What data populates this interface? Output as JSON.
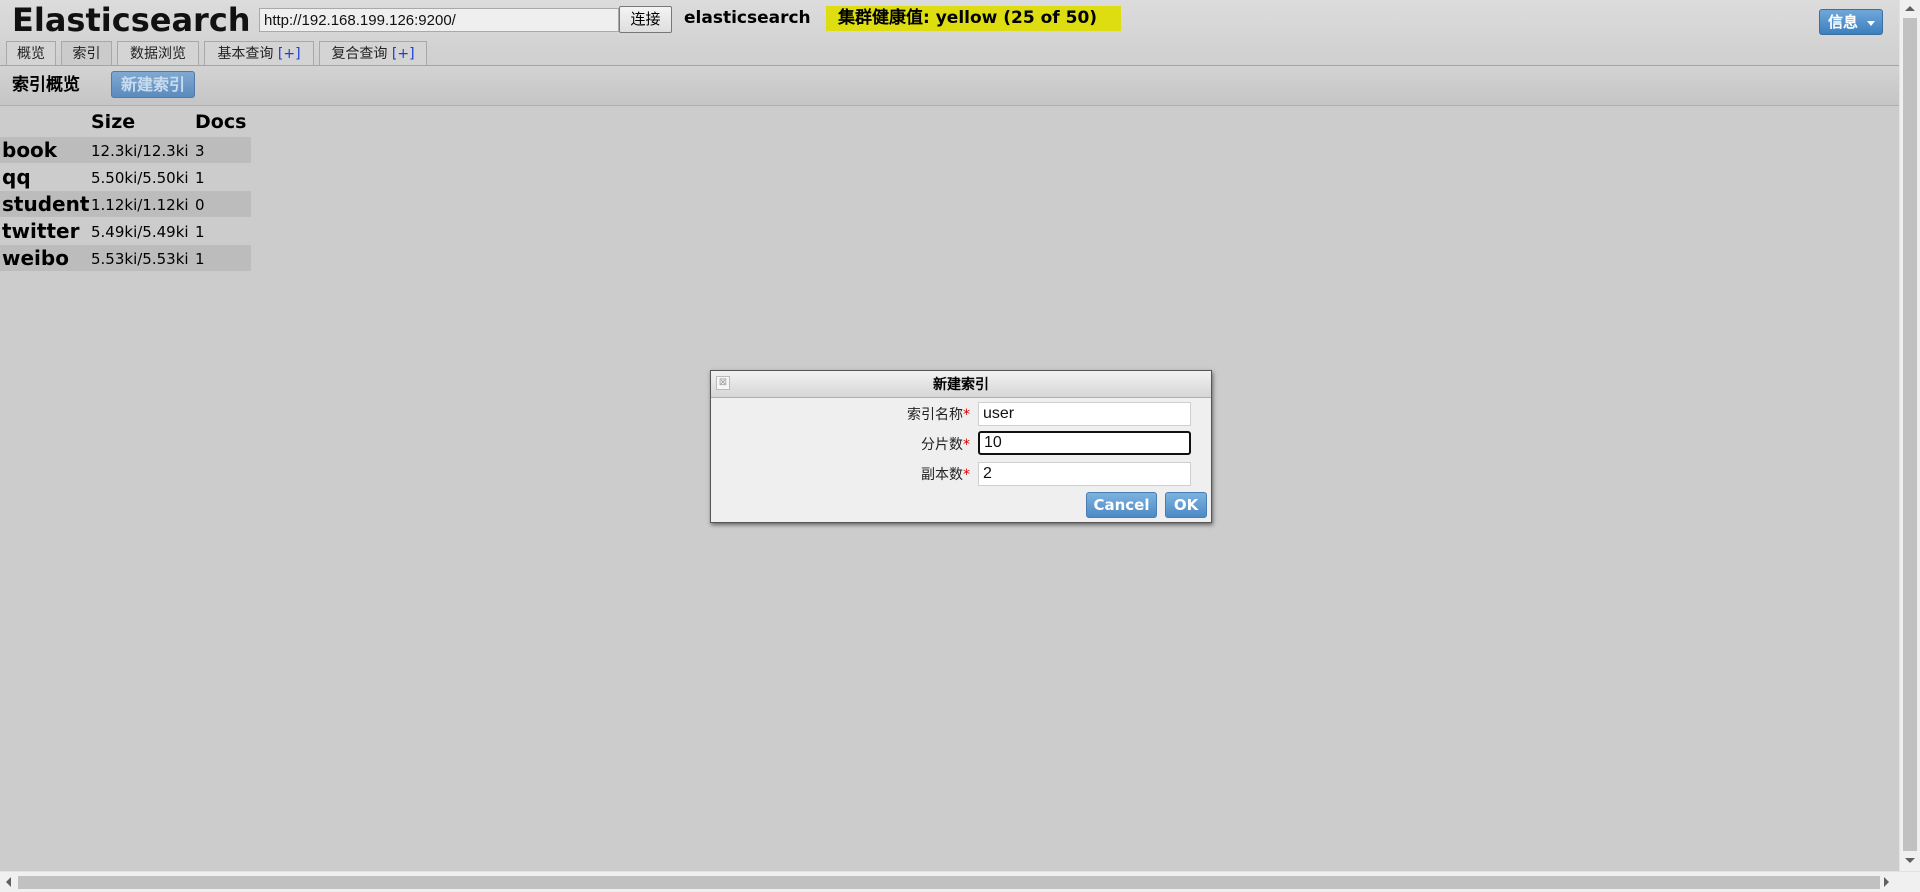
{
  "header": {
    "app_title": "Elasticsearch",
    "url_value": "http://192.168.199.126:9200/",
    "connect_label": "连接",
    "cluster_name": "elasticsearch",
    "health_text": "集群健康值: yellow (25 of 50)",
    "health_color": "#dddd11",
    "info_label": "信息"
  },
  "tabs": [
    {
      "label": "概览",
      "plus": ""
    },
    {
      "label": "索引",
      "plus": ""
    },
    {
      "label": "数据浏览",
      "plus": ""
    },
    {
      "label": "基本查询 ",
      "plus": "[+]"
    },
    {
      "label": "复合查询 ",
      "plus": "[+]"
    }
  ],
  "toolbar": {
    "title": "索引概览",
    "new_index_label": "新建索引"
  },
  "index_table": {
    "headers": [
      "Size",
      "Docs"
    ],
    "rows": [
      {
        "name": "book",
        "size": "12.3ki/12.3ki",
        "docs": "3"
      },
      {
        "name": "qq",
        "size": "5.50ki/5.50ki",
        "docs": "1"
      },
      {
        "name": "student",
        "size": "1.12ki/1.12ki",
        "docs": "0"
      },
      {
        "name": "twitter",
        "size": "5.49ki/5.49ki",
        "docs": "1"
      },
      {
        "name": "weibo",
        "size": "5.53ki/5.53ki",
        "docs": "1"
      }
    ]
  },
  "dialog": {
    "title": "新建索引",
    "close_glyph": "⊠",
    "required_mark": "*",
    "fields": [
      {
        "label": "索引名称",
        "value": "user"
      },
      {
        "label": "分片数",
        "value": "10"
      },
      {
        "label": "副本数",
        "value": "2"
      }
    ],
    "cancel_label": "Cancel",
    "ok_label": "OK"
  }
}
